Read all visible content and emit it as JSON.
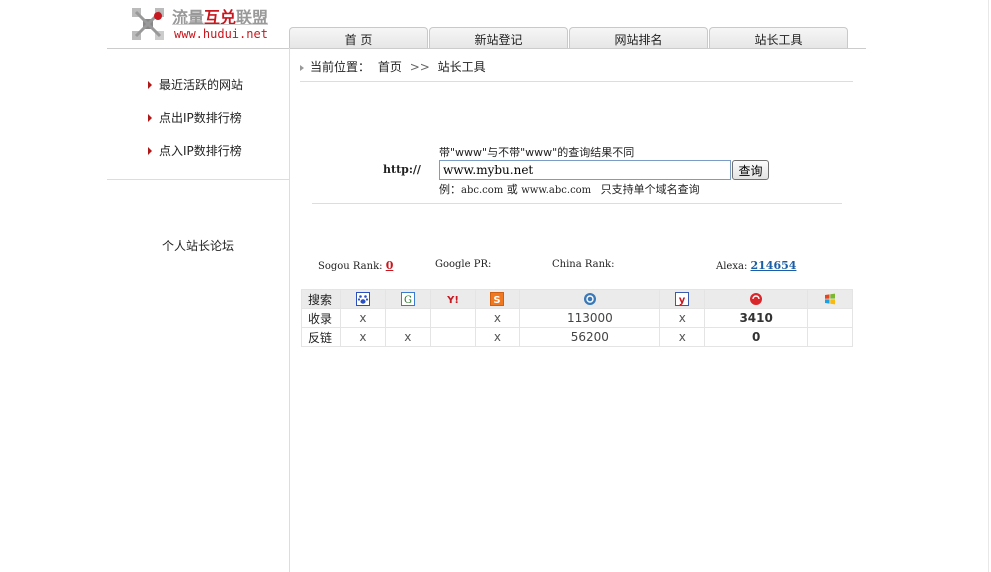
{
  "logo": {
    "title_part1": "流量",
    "title_part2": "互兑",
    "title_part3": "联盟",
    "url": "www.hudui.net"
  },
  "nav": {
    "tabs": [
      "首 页",
      "新站登记",
      "网站排名",
      "站长工具"
    ]
  },
  "sidebar": {
    "items": [
      "最近活跃的网站",
      "点出IP数排行榜",
      "点入IP数排行榜"
    ],
    "forum": "个人站长论坛"
  },
  "breadcrumb": {
    "label": "当前位置：",
    "home": "首页",
    "sep": ">>",
    "current": "站长工具"
  },
  "query": {
    "hint": "带\"www\"与不带\"www\"的查询结果不同",
    "prefix": "http://",
    "value": "www.mybu.net",
    "button": "查询",
    "example_prefix": "例：",
    "example_a": "abc.com",
    "example_or": "或",
    "example_b": "www.abc.com",
    "example_note": "只支持单个域名查询"
  },
  "ranks": {
    "sogou_label": "Sogou Rank:",
    "sogou_value": "0",
    "google_label": "Google PR:",
    "china_label": "China Rank:",
    "alexa_label": "Alexa:",
    "alexa_value": "214654"
  },
  "results": {
    "header_label": "搜索",
    "engines": [
      "baidu-icon",
      "google-icon",
      "yahoo-icon",
      "sogou-icon",
      "soso-icon",
      "youdao-icon",
      "360-icon",
      "bing-icon"
    ],
    "rows": [
      {
        "label": "收录",
        "cells": [
          "x",
          "",
          "",
          "x",
          "113000",
          "x",
          "3410",
          ""
        ]
      },
      {
        "label": "反链",
        "cells": [
          "x",
          "x",
          "",
          "x",
          "56200",
          "x",
          "0",
          ""
        ]
      }
    ]
  },
  "colors": {
    "brand_red": "#c8171e",
    "link_blue": "#1a5ea8"
  }
}
